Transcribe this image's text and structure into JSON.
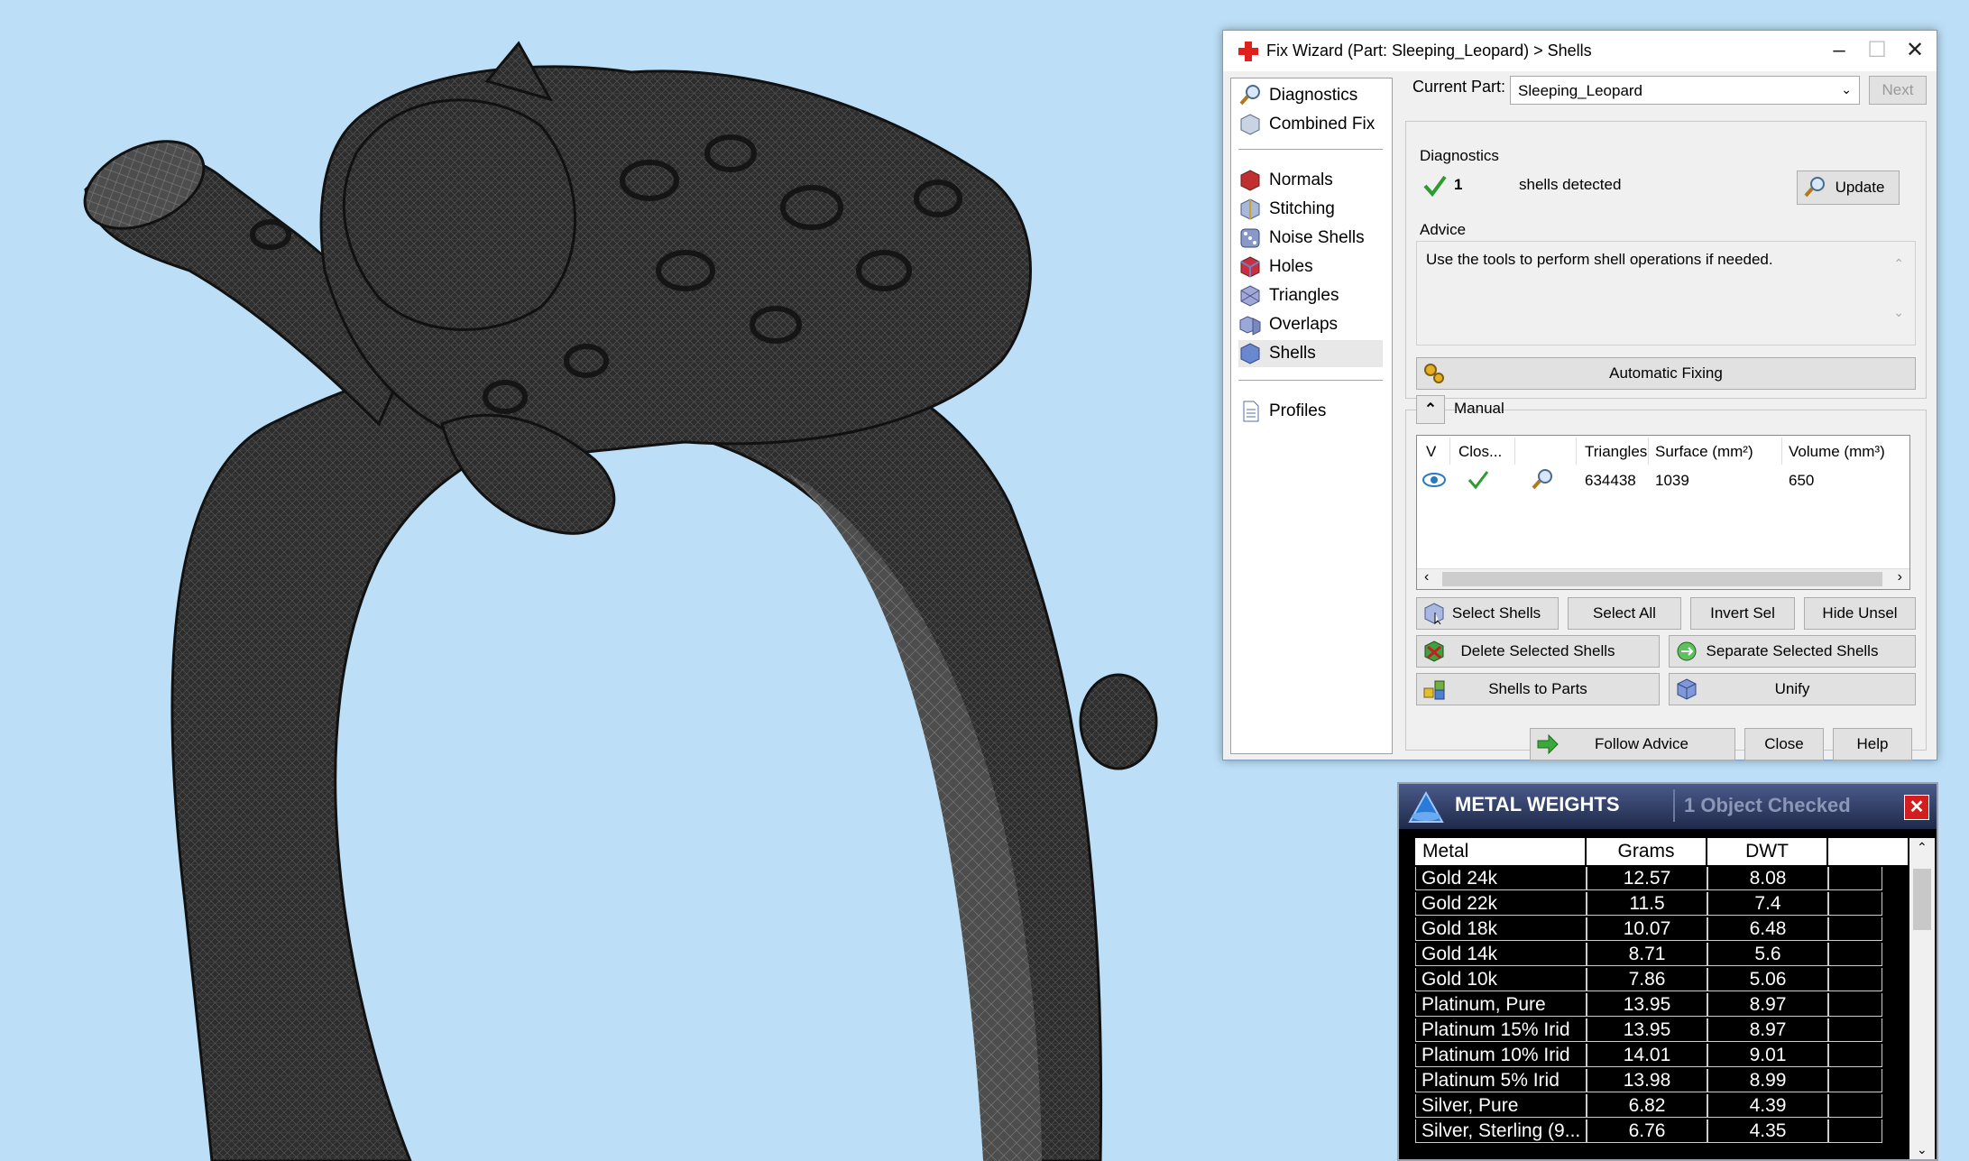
{
  "wizard": {
    "title": "Fix Wizard (Part: Sleeping_Leopard) > Shells",
    "nav_items": [
      {
        "label": "Diagnostics",
        "icon": "magnifier-icon"
      },
      {
        "label": "Combined Fix",
        "icon": "cube-icon"
      },
      {
        "label": "Normals",
        "icon": "cube-red-icon"
      },
      {
        "label": "Stitching",
        "icon": "cube-stitch-icon"
      },
      {
        "label": "Noise Shells",
        "icon": "dice-icon"
      },
      {
        "label": "Holes",
        "icon": "cube-hole-icon"
      },
      {
        "label": "Triangles",
        "icon": "triangle-cube-icon"
      },
      {
        "label": "Overlaps",
        "icon": "overlap-icon"
      },
      {
        "label": "Shells",
        "icon": "shell-cube-icon"
      },
      {
        "label": "Profiles",
        "icon": "document-icon"
      }
    ],
    "current_part_label": "Current Part:",
    "current_part_value": "Sleeping_Leopard",
    "next_label": "Next",
    "diagnostics_title": "Diagnostics",
    "shell_count": "1",
    "shell_text": "shells detected",
    "update_label": "Update",
    "advice_title": "Advice",
    "advice_text": "Use the tools to perform shell operations if needed.",
    "auto_fix_label": "Automatic Fixing",
    "manual_label": "Manual",
    "table": {
      "headers": [
        "V",
        "Clos...",
        "",
        "Triangles",
        "Surface (mm²)",
        "Volume (mm³)"
      ],
      "row": {
        "triangles": "634438",
        "surface": "1039",
        "volume": "650"
      }
    },
    "buttons": {
      "select_shells": "Select Shells",
      "select_all": "Select All",
      "invert_sel": "Invert Sel",
      "hide_unsel": "Hide Unsel",
      "delete_selected": "Delete Selected Shells",
      "separate_selected": "Separate Selected Shells",
      "shells_to_parts": "Shells to Parts",
      "unify": "Unify",
      "follow_advice": "Follow Advice",
      "close": "Close",
      "help": "Help"
    }
  },
  "metal_weights": {
    "title": "METAL WEIGHTS",
    "info": "1 Object Checked",
    "headers": [
      "Metal",
      "Grams",
      "DWT"
    ],
    "rows": [
      {
        "metal": "Gold 24k",
        "grams": "12.57",
        "dwt": "8.08"
      },
      {
        "metal": "Gold 22k",
        "grams": "11.5",
        "dwt": "7.4"
      },
      {
        "metal": "Gold 18k",
        "grams": "10.07",
        "dwt": "6.48"
      },
      {
        "metal": "Gold 14k",
        "grams": "8.71",
        "dwt": "5.6"
      },
      {
        "metal": "Gold 10k",
        "grams": "7.86",
        "dwt": "5.06"
      },
      {
        "metal": "Platinum, Pure",
        "grams": "13.95",
        "dwt": "8.97"
      },
      {
        "metal": "Platinum 15% Irid",
        "grams": "13.95",
        "dwt": "8.97"
      },
      {
        "metal": "Platinum 10% Irid",
        "grams": "14.01",
        "dwt": "9.01"
      },
      {
        "metal": "Platinum 5% Irid",
        "grams": "13.98",
        "dwt": "8.99"
      },
      {
        "metal": "Silver, Pure",
        "grams": "6.82",
        "dwt": "4.39"
      },
      {
        "metal": "Silver, Sterling (9...",
        "grams": "6.76",
        "dwt": "4.35"
      }
    ]
  },
  "colors": {
    "viewport_bg": "#bcdff7",
    "model": "#2b2b2b",
    "accent_green": "#2e9b2e",
    "close_red": "#d21e1e"
  }
}
